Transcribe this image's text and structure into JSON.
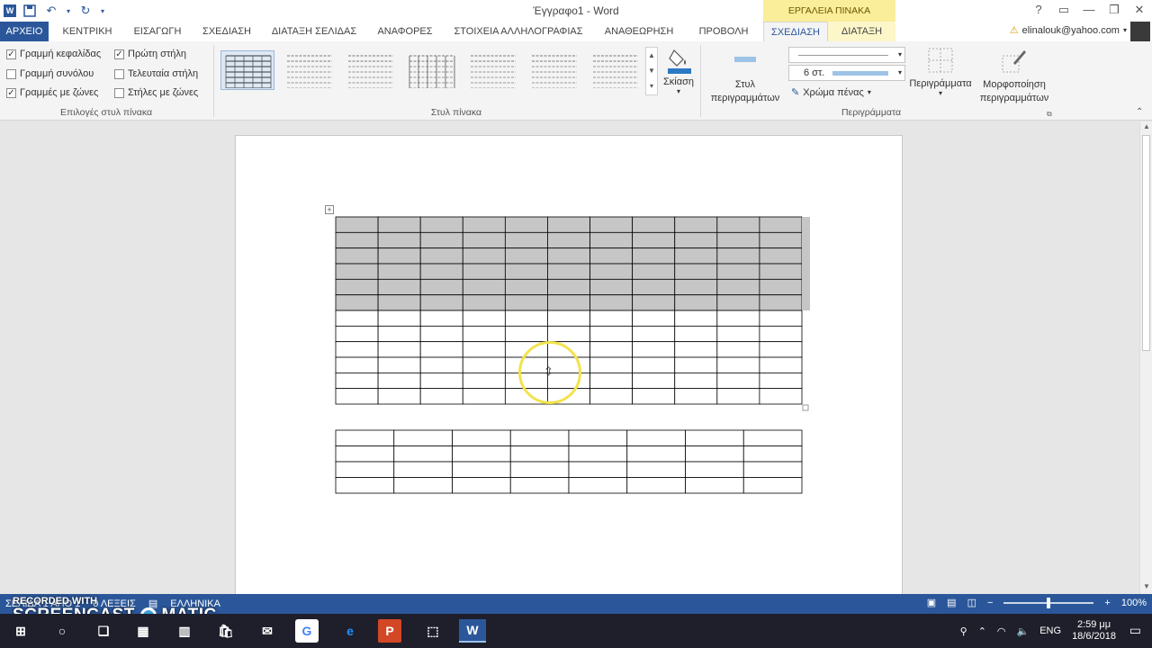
{
  "window": {
    "title": "Έγγραφο1 - Word",
    "context_group": "ΕΡΓΑΛΕΙΑ ΠΙΝΑΚΑ",
    "controls": [
      "?",
      "▭",
      "—",
      "❐",
      "✕"
    ]
  },
  "quick_access": {
    "icons": [
      "word-icon",
      "save-icon",
      "undo-icon",
      "redo-icon",
      "customize-icon"
    ]
  },
  "tabs": [
    {
      "label": "ΑΡΧΕΙΟ"
    },
    {
      "label": "ΚΕΝΤΡΙΚΗ"
    },
    {
      "label": "ΕΙΣΑΓΩΓΗ"
    },
    {
      "label": "ΣΧΕΔΙΑΣΗ"
    },
    {
      "label": "ΔΙΑΤΑΞΗ ΣΕΛΙΔΑΣ"
    },
    {
      "label": "ΑΝΑΦΟΡΕΣ"
    },
    {
      "label": "ΣΤΟΙΧΕΙΑ ΑΛΛΗΛΟΓΡΑΦΙΑΣ"
    },
    {
      "label": "ΑΝΑΘΕΩΡΗΣΗ"
    },
    {
      "label": "ΠΡΟΒΟΛΗ"
    },
    {
      "label": "ΣΧΕΔΙΑΣΗ"
    },
    {
      "label": "ΔΙΑΤΑΞΗ"
    }
  ],
  "account": {
    "email": "elinalouk@yahoo.com"
  },
  "ribbon": {
    "style_options": {
      "label": "Επιλογές στυλ πίνακα",
      "options": [
        {
          "label": "Γραμμή κεφαλίδας",
          "checked": true,
          "mark": "✓"
        },
        {
          "label": "Γραμμή συνόλου",
          "checked": false,
          "mark": ""
        },
        {
          "label": "Γραμμές με ζώνες",
          "checked": true,
          "mark": "✓"
        },
        {
          "label": "Πρώτη στήλη",
          "checked": true,
          "mark": "✓"
        },
        {
          "label": "Τελευταία στήλη",
          "checked": false,
          "mark": ""
        },
        {
          "label": "Στήλες με ζώνες",
          "checked": false,
          "mark": ""
        }
      ]
    },
    "table_styles": {
      "label": "Στυλ πίνακα",
      "count": 7,
      "selected": 0
    },
    "shading": {
      "label": "Σκίαση"
    },
    "borders": {
      "label": "Περιγράμματα",
      "border_styles": "Στυλ περιγραμμάτων",
      "pen_weight": "6 στ.",
      "pen_color": "Χρώμα πένας",
      "borders_btn": "Περιγράμματα",
      "border_painter": "Μορφοποίηση περιγραμμάτων"
    }
  },
  "document": {
    "table1": {
      "cols": 11,
      "rows": 12,
      "shaded_rows": 6
    },
    "table2": {
      "cols": 8,
      "rows": 4
    }
  },
  "statusbar": {
    "page_info": "ΣΕΛΙΔΑ 1 ΑΠΟ 1",
    "words": "0 ΛΕΞΕΙΣ",
    "language": "ΕΛΛΗΝΙΚΑ",
    "zoom": "100%"
  },
  "watermark": {
    "line1": "RECORDED WITH",
    "line2": "SCREENCAST",
    "line3": "MATIC"
  },
  "taskbar": {
    "language": "ENG",
    "time": "2:59 μμ",
    "date": "18/6/2018"
  }
}
